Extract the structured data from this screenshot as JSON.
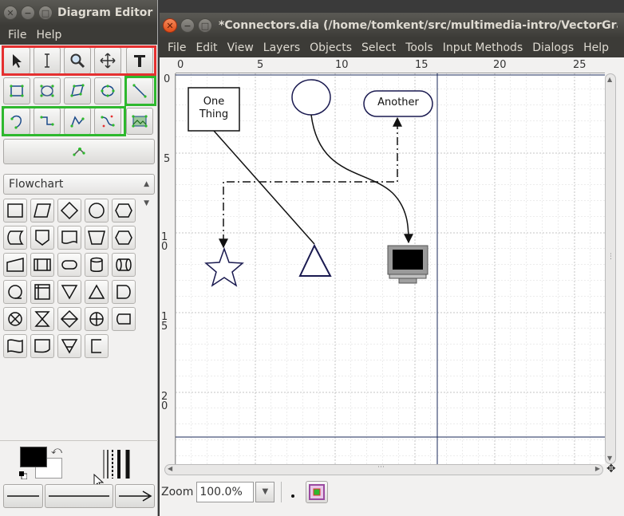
{
  "left_window": {
    "title": "Diagram Editor",
    "menu": [
      "File",
      "Help"
    ],
    "shape_sheet": "Flowchart"
  },
  "right_window": {
    "title": "*Connectors.dia (/home/tomkent/src/multimedia-intro/VectorGraphics",
    "menu": [
      "File",
      "Edit",
      "View",
      "Layers",
      "Objects",
      "Select",
      "Tools",
      "Input Methods",
      "Dialogs",
      "Help"
    ],
    "zoom_label": "Zoom",
    "zoom_value": "100.0%",
    "ruler_h": [
      "0",
      "5",
      "10",
      "15",
      "20",
      "25"
    ],
    "ruler_v": [
      "0",
      "5",
      "10",
      "15",
      "20"
    ]
  },
  "diagram": {
    "box_label_line1": "One",
    "box_label_line2": "Thing",
    "pill_label": "Another"
  },
  "colors": {
    "highlight_red": "#e53030",
    "highlight_green": "#2eb82e",
    "titlebar": "#3c3b37"
  }
}
